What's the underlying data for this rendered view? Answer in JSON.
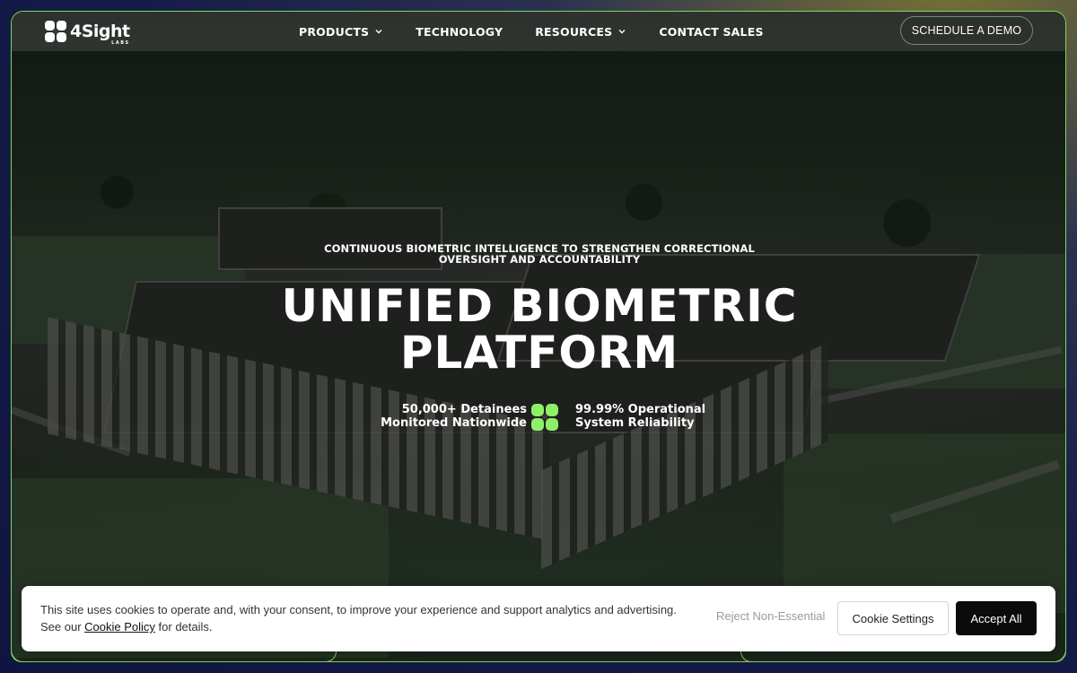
{
  "brand": {
    "logo_text": "4Sight",
    "logo_sub": "LABS",
    "accent": "#7ed957"
  },
  "nav": {
    "items": [
      {
        "label": "PRODUCTS",
        "has_dropdown": true
      },
      {
        "label": "TECHNOLOGY",
        "has_dropdown": false
      },
      {
        "label": "RESOURCES",
        "has_dropdown": true
      },
      {
        "label": "CONTACT SALES",
        "has_dropdown": false
      }
    ],
    "cta_label": "SCHEDULE A DEMO"
  },
  "hero": {
    "kicker_line1": "CONTINUOUS BIOMETRIC INTELLIGENCE TO STRENGTHEN CORRECTIONAL",
    "kicker_line2": "OVERSIGHT AND ACCOUNTABILITY",
    "headline_line1": "UNIFIED BIOMETRIC",
    "headline_line2": "PLATFORM",
    "stat_left_line1": "50,000+ Detainees",
    "stat_left_line2": "Monitored Nationwide",
    "stat_right_line1": "99.99% Operational",
    "stat_right_line2": "System Reliability",
    "stat_icon": "clover-icon"
  },
  "cookie": {
    "text_line1": "This site uses cookies to operate and, with your consent, to improve your experience and support analytics and advertising.",
    "text_pre": "See our ",
    "link_label": "Cookie Policy",
    "text_post": " for details.",
    "reject_label": "Reject Non-Essential",
    "settings_label": "Cookie Settings",
    "accept_label": "Accept All"
  }
}
